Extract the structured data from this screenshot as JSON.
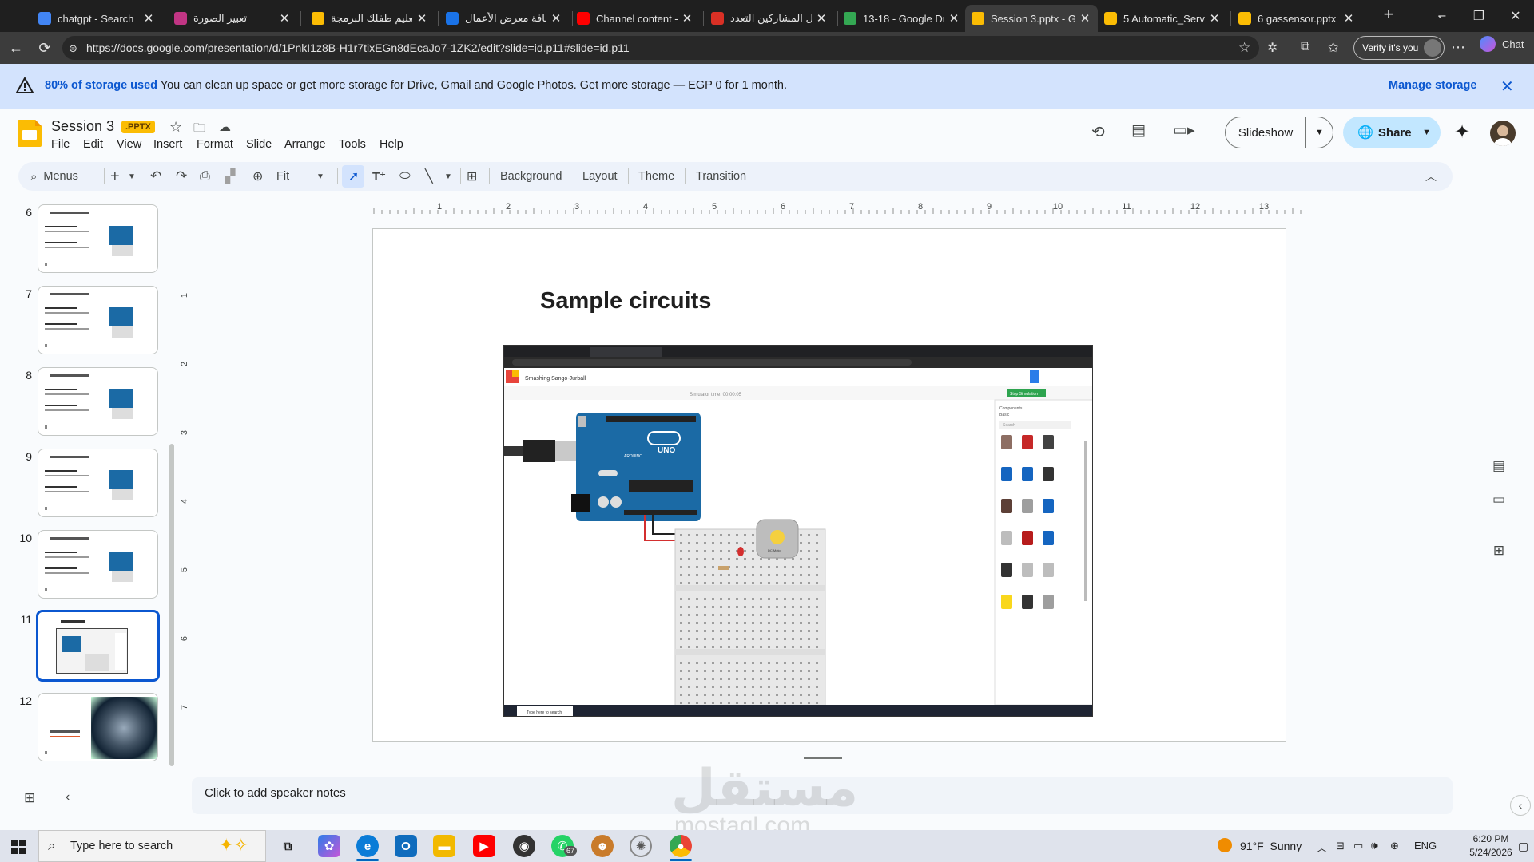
{
  "browser": {
    "tabs": [
      {
        "title": "chatgpt - Search",
        "icon": "search-icon",
        "color": "#4285f4"
      },
      {
        "title": "تعبير الصورة",
        "icon": "instagram-icon",
        "color": "#c13584"
      },
      {
        "title": "تعليم طفلك البرمجة ..",
        "icon": "slides-file-icon",
        "color": "#fbbc04"
      },
      {
        "title": "إضافة معرض الأعمال",
        "icon": "site-icon",
        "color": "#1a73e8"
      },
      {
        "title": "Channel content - Yo",
        "icon": "youtube-icon",
        "color": "#ff0000"
      },
      {
        "title": "دليل المشاركين التعدد",
        "icon": "pdf-icon",
        "color": "#d93025"
      },
      {
        "title": "13-18 - Google Drive",
        "icon": "drive-icon",
        "color": "#34a853"
      },
      {
        "title": "Session 3.pptx - Goo",
        "icon": "slides-file-icon",
        "color": "#fbbc04",
        "active": true
      },
      {
        "title": "5 Automatic_Servo_",
        "icon": "slides-file-icon",
        "color": "#fbbc04"
      },
      {
        "title": "6 gassensor.pptx - Go",
        "icon": "slides-file-icon",
        "color": "#fbbc04"
      }
    ],
    "url": "https://docs.google.com/presentation/d/1PnkI1z8B-H1r7tixEGn8dEcaJo7-1ZK2/edit?slide=id.p11#slide=id.p11",
    "verify_label": "Verify it's you",
    "chat_label": "Chat"
  },
  "banner": {
    "bold": "80% of storage used",
    "text": " You can clean up space or get more storage for Drive, Gmail and Google Photos. Get more storage — EGP 0 for 1 month.",
    "manage_label": "Manage storage"
  },
  "doc": {
    "title": "Session 3",
    "badge": ".PPTX",
    "menus": [
      "File",
      "Edit",
      "View",
      "Insert",
      "Format",
      "Slide",
      "Arrange",
      "Tools",
      "Help"
    ],
    "slideshow_label": "Slideshow",
    "share_label": "Share"
  },
  "toolbar": {
    "menus_label": "Menus",
    "zoom_label": "Fit",
    "background_label": "Background",
    "layout_label": "Layout",
    "theme_label": "Theme",
    "transition_label": "Transition"
  },
  "ruler": {
    "h": [
      "1",
      "2",
      "3",
      "4",
      "5",
      "6",
      "7",
      "8",
      "9",
      "10",
      "11",
      "12",
      "13"
    ],
    "v": [
      "1",
      "2",
      "3",
      "4",
      "5",
      "6",
      "7"
    ]
  },
  "filmstrip": [
    {
      "num": "6"
    },
    {
      "num": "7"
    },
    {
      "num": "8"
    },
    {
      "num": "9"
    },
    {
      "num": "10"
    },
    {
      "num": "11",
      "selected": true
    },
    {
      "num": "12"
    }
  ],
  "slide": {
    "title": "Sample circuits",
    "screenshot": {
      "project_title": "Smashing Sango-Jurball",
      "sim_time": "Simulator time: 00:00:05",
      "stop_label": "Stop Simulation",
      "components_label": "Components",
      "basic_label": "Basic",
      "search_label": "Search",
      "taskbar_search": "Type here to search",
      "board_text": "UNO",
      "board_brand": "ARDUINO",
      "motor_label": "DC Motor"
    }
  },
  "notes": {
    "placeholder": "Click to add speaker notes"
  },
  "taskbar": {
    "search_placeholder": "Type here to search",
    "weather_temp": "91°F",
    "weather_text": "Sunny",
    "lang": "ENG",
    "time": "6:20 PM",
    "date": "5/24/2026",
    "whatsapp_badge": "67"
  },
  "watermark": {
    "main": "مستقل",
    "sub": "mostaql.com"
  }
}
